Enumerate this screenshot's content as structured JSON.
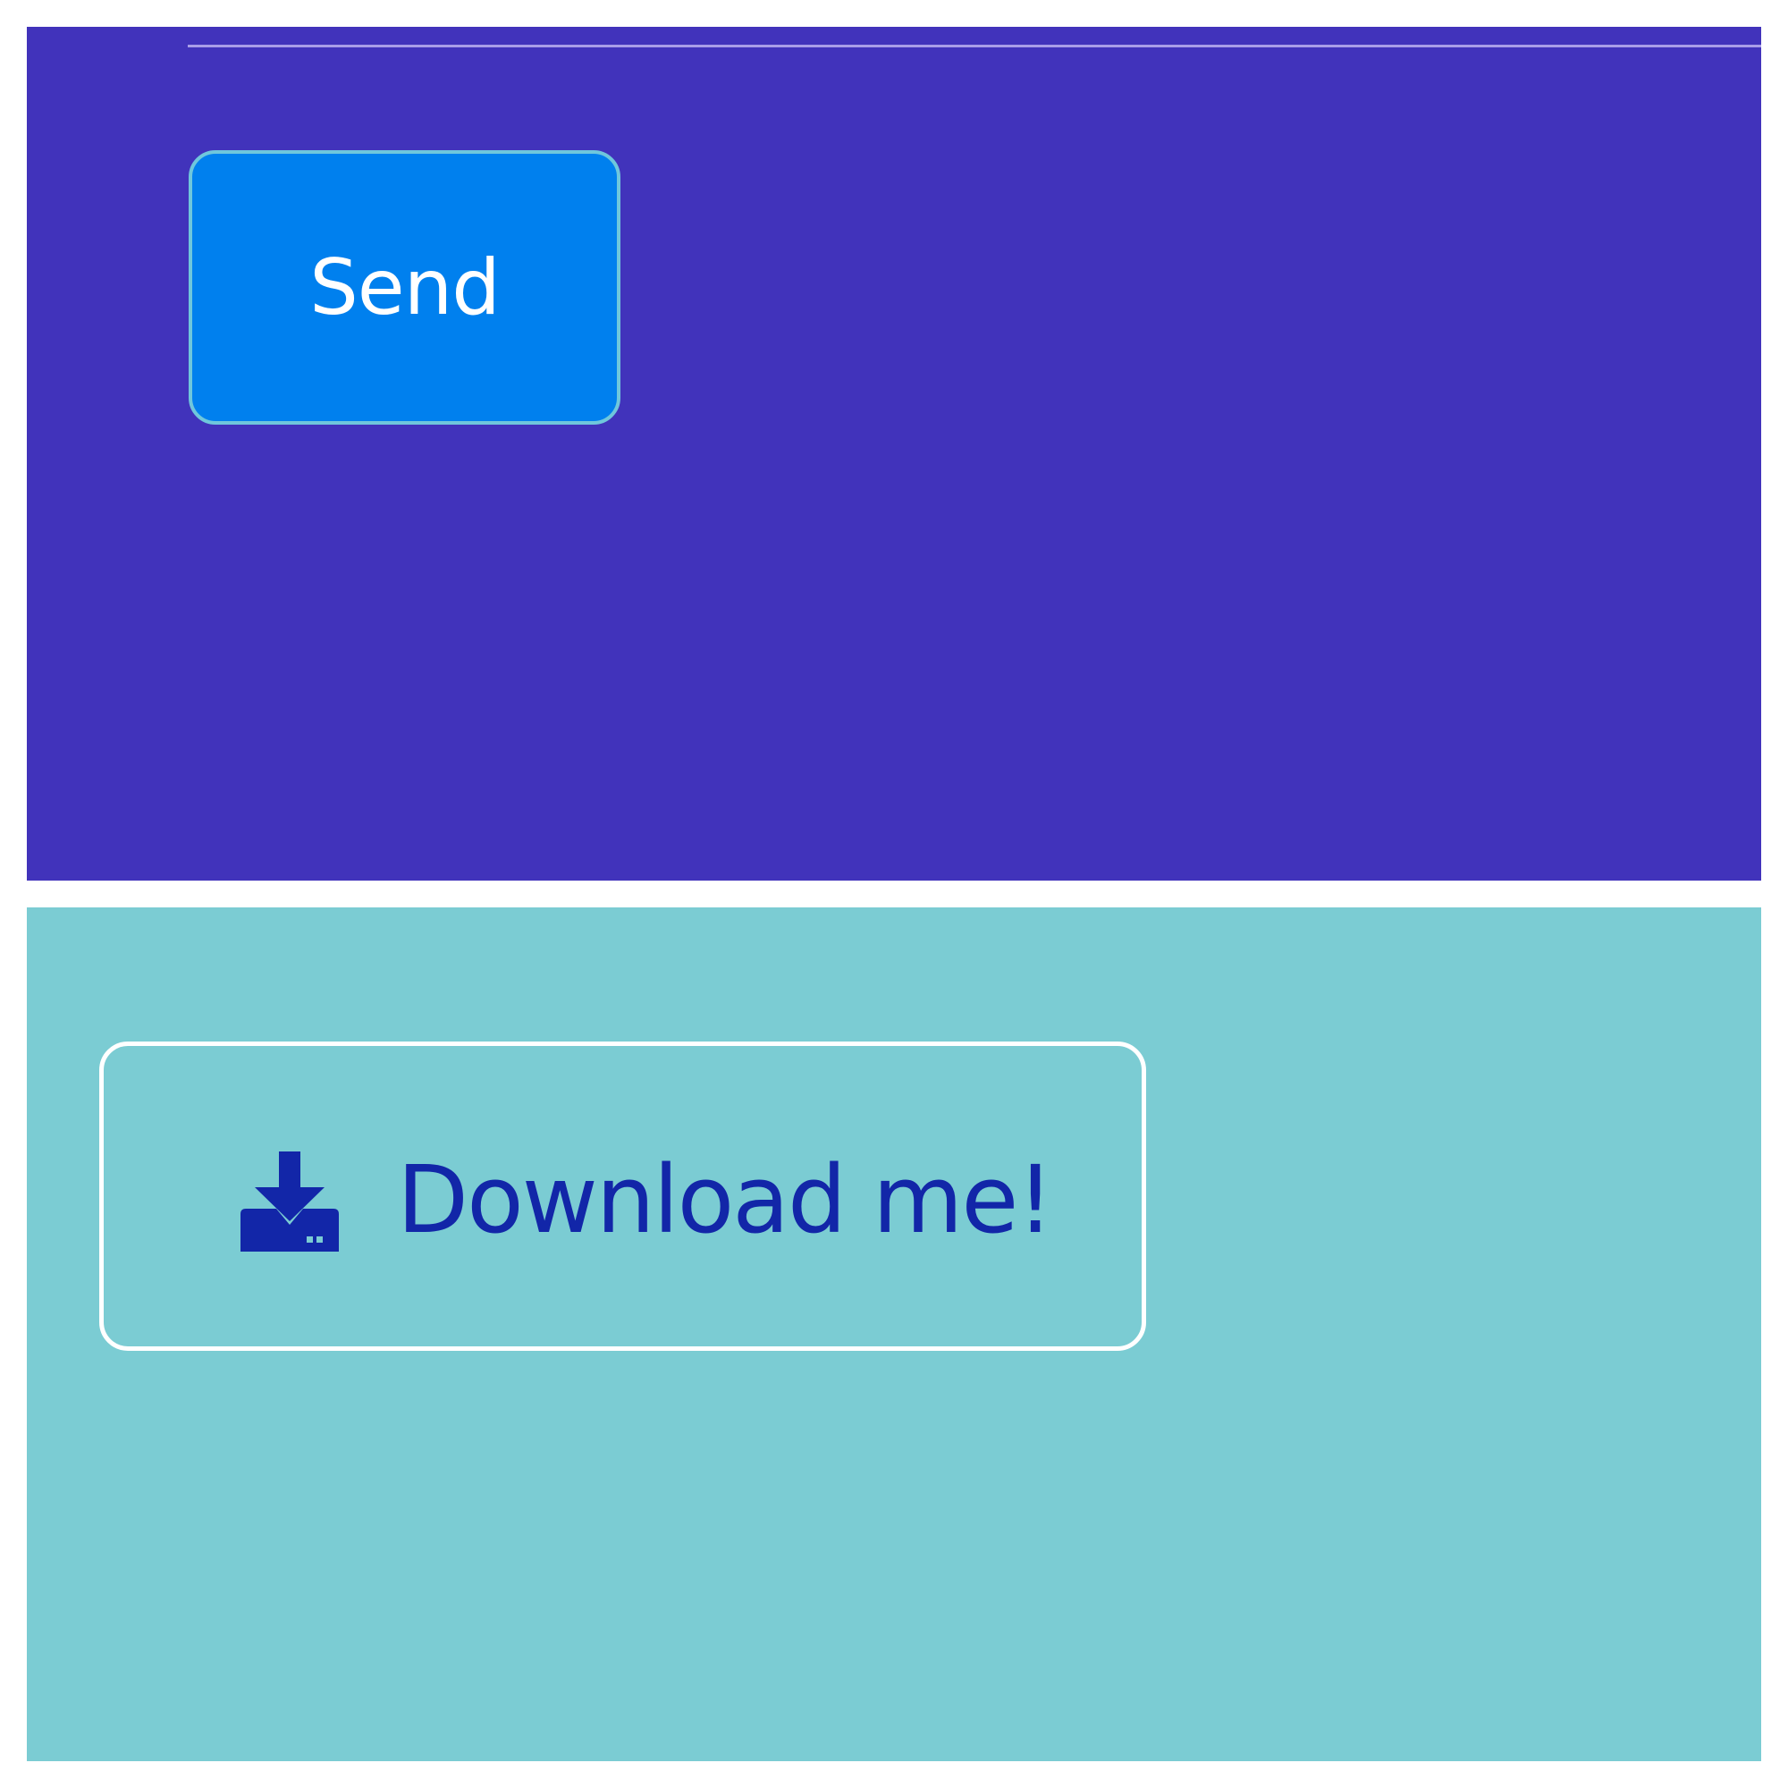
{
  "colors": {
    "top_panel_bg": "#4133bb",
    "send_button_bg": "#0080ee",
    "send_button_border": "#6fc7dc",
    "bottom_panel_bg": "#7bccd3",
    "download_button_border": "#ffffff",
    "download_text": "#1226a8"
  },
  "top_panel": {
    "send_button": {
      "label": "Send"
    }
  },
  "bottom_panel": {
    "download_button": {
      "icon": "download-icon",
      "label": "Download me!"
    }
  }
}
